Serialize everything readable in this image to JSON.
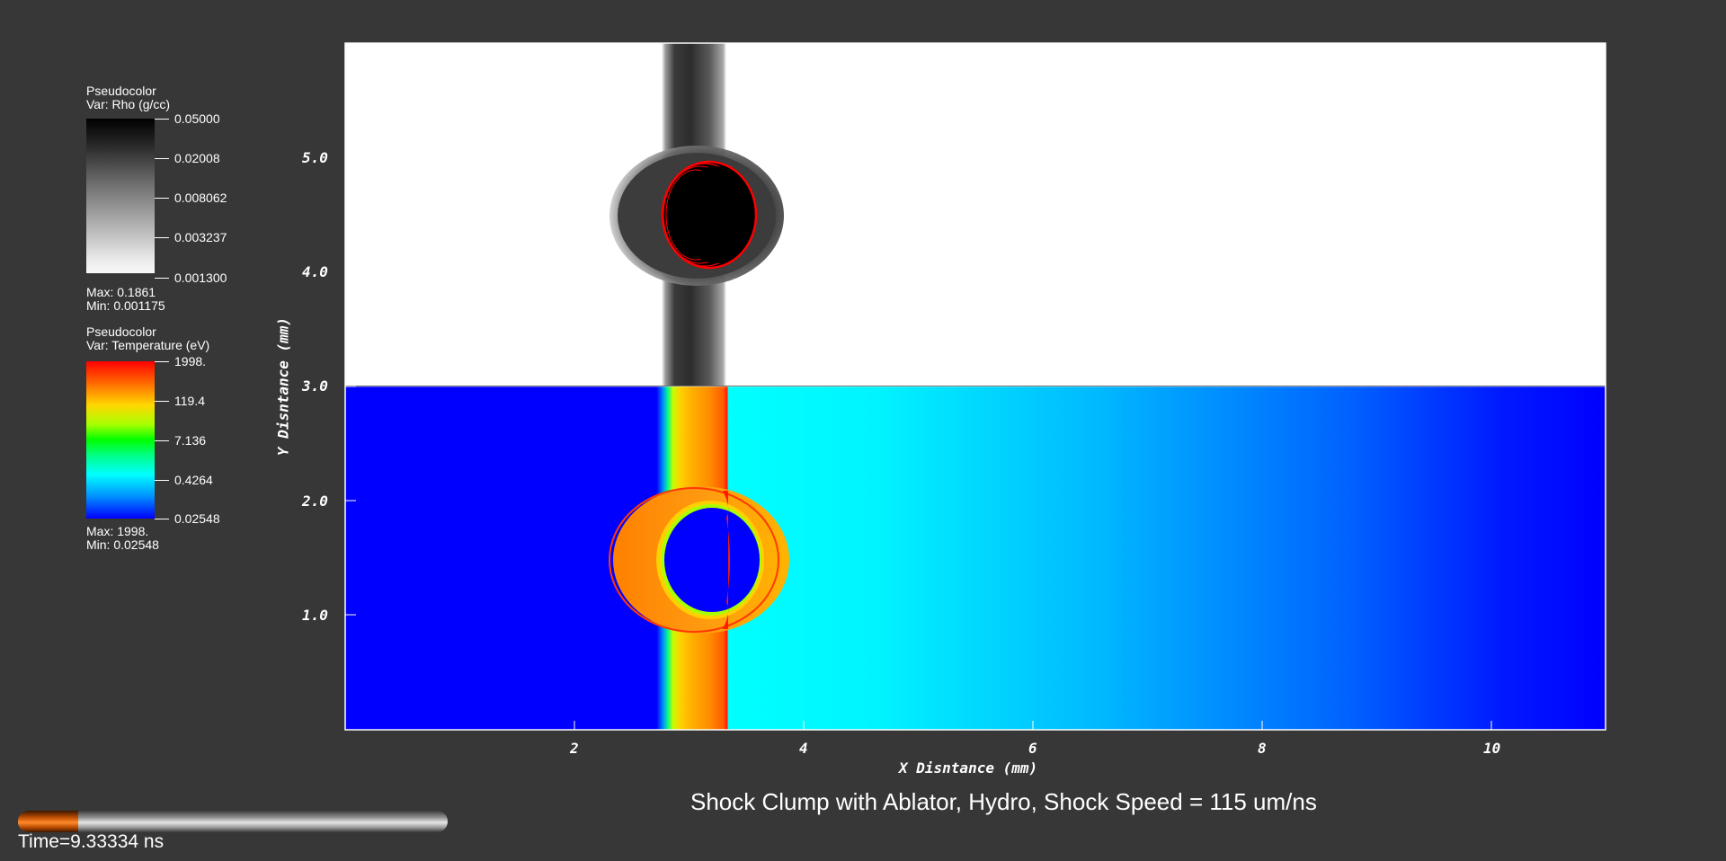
{
  "legends": {
    "rho": {
      "plot_type": "Pseudocolor",
      "var_label": "Var: Rho (g/cc)",
      "ticks": [
        "0.05000",
        "0.02008",
        "0.008062",
        "0.003237",
        "0.001300"
      ],
      "max_label": "Max:  0.1861",
      "min_label": "Min:  0.001175"
    },
    "temperature": {
      "plot_type": "Pseudocolor",
      "var_label": "Var: Temperature (eV)",
      "ticks": [
        "1998.",
        "119.4",
        "7.136",
        "0.4264",
        "0.02548"
      ],
      "max_label": "Max:  1998.",
      "min_label": "Min:  0.02548"
    }
  },
  "plot": {
    "x_axis_label": "X Disntance (mm)",
    "y_axis_label": "Y Disntance (mm)",
    "x_ticks": [
      "2",
      "4",
      "6",
      "8",
      "10"
    ],
    "y_ticks": [
      "1.0",
      "2.0",
      "3.0",
      "4.0",
      "5.0"
    ],
    "x_range": [
      0,
      11
    ],
    "y_range": [
      0,
      6
    ],
    "upper_panel_variable": "Rho",
    "lower_panel_variable": "Temperature",
    "colors": {
      "background": "#373737",
      "rho_background": "#ffffff",
      "clump_outline": "#ff0000",
      "temp_cold": "#0000ff",
      "temp_hot": "#ff0000"
    }
  },
  "title": "Shock Clump with Ablator, Hydro, Shock Speed = 115 um/ns",
  "time": {
    "label": "Time=9.33334 ns",
    "progress_fraction": 0.14
  }
}
